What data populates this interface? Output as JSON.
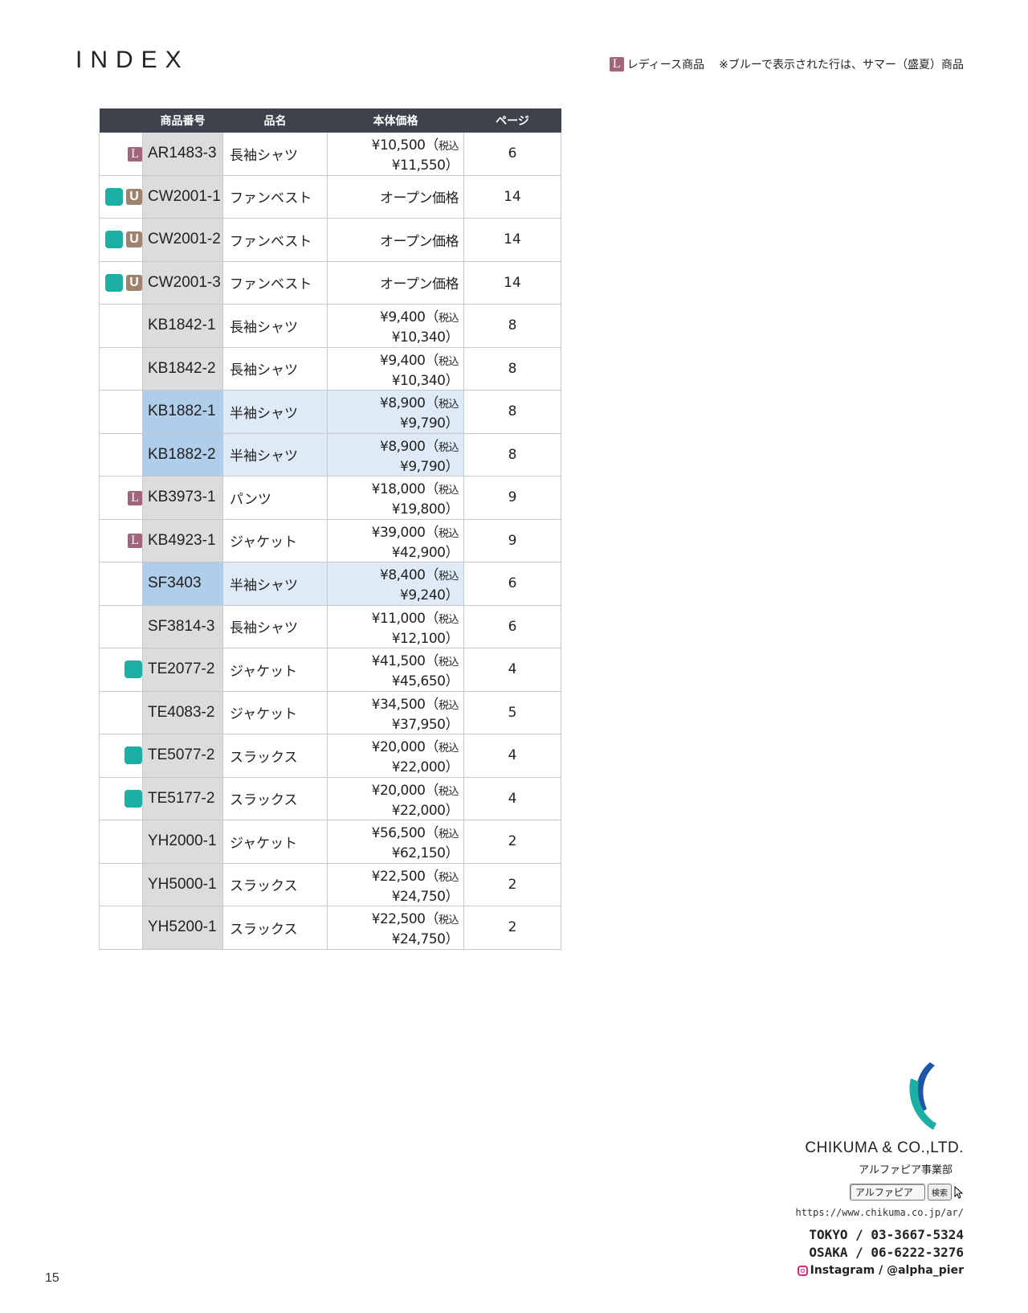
{
  "title": "INDEX",
  "legend": {
    "ladies_badge": "L",
    "ladies_label": "レディース商品",
    "summer_note": "※ブルーで表示された行は、サマー（盛夏）商品"
  },
  "table": {
    "headers": [
      "商品番号",
      "品名",
      "本体価格",
      "ページ"
    ],
    "rows": [
      {
        "badges": [
          "L"
        ],
        "code": "AR1483-3",
        "name": "長袖シャツ",
        "price": "¥10,500",
        "tax_label": "税込",
        "tax_price": "¥11,550",
        "page": "6",
        "summer": false
      },
      {
        "badges": [
          "T",
          "U"
        ],
        "code": "CW2001-1",
        "name": "ファンベスト",
        "price": "オープン価格",
        "tax_label": "",
        "tax_price": "",
        "page": "14",
        "summer": false
      },
      {
        "badges": [
          "T",
          "U"
        ],
        "code": "CW2001-2",
        "name": "ファンベスト",
        "price": "オープン価格",
        "tax_label": "",
        "tax_price": "",
        "page": "14",
        "summer": false
      },
      {
        "badges": [
          "T",
          "U"
        ],
        "code": "CW2001-3",
        "name": "ファンベスト",
        "price": "オープン価格",
        "tax_label": "",
        "tax_price": "",
        "page": "14",
        "summer": false
      },
      {
        "badges": [],
        "code": "KB1842-1",
        "name": "長袖シャツ",
        "price": "¥9,400",
        "tax_label": "税込",
        "tax_price": "¥10,340",
        "page": "8",
        "summer": false
      },
      {
        "badges": [],
        "code": "KB1842-2",
        "name": "長袖シャツ",
        "price": "¥9,400",
        "tax_label": "税込",
        "tax_price": "¥10,340",
        "page": "8",
        "summer": false
      },
      {
        "badges": [],
        "code": "KB1882-1",
        "name": "半袖シャツ",
        "price": "¥8,900",
        "tax_label": "税込",
        "tax_price": "¥9,790",
        "page": "8",
        "summer": true
      },
      {
        "badges": [],
        "code": "KB1882-2",
        "name": "半袖シャツ",
        "price": "¥8,900",
        "tax_label": "税込",
        "tax_price": "¥9,790",
        "page": "8",
        "summer": true
      },
      {
        "badges": [
          "L"
        ],
        "code": "KB3973-1",
        "name": "パンツ",
        "price": "¥18,000",
        "tax_label": "税込",
        "tax_price": "¥19,800",
        "page": "9",
        "summer": false
      },
      {
        "badges": [
          "L"
        ],
        "code": "KB4923-1",
        "name": "ジャケット",
        "price": "¥39,000",
        "tax_label": "税込",
        "tax_price": "¥42,900",
        "page": "9",
        "summer": false
      },
      {
        "badges": [],
        "code": "SF3403",
        "name": "半袖シャツ",
        "price": "¥8,400",
        "tax_label": "税込",
        "tax_price": "¥9,240",
        "page": "6",
        "summer": true
      },
      {
        "badges": [],
        "code": "SF3814-3",
        "name": "長袖シャツ",
        "price": "¥11,000",
        "tax_label": "税込",
        "tax_price": "¥12,100",
        "page": "6",
        "summer": false
      },
      {
        "badges": [
          "T"
        ],
        "code": "TE2077-2",
        "name": "ジャケット",
        "price": "¥41,500",
        "tax_label": "税込",
        "tax_price": "¥45,650",
        "page": "4",
        "summer": false
      },
      {
        "badges": [],
        "code": "TE4083-2",
        "name": "ジャケット",
        "price": "¥34,500",
        "tax_label": "税込",
        "tax_price": "¥37,950",
        "page": "5",
        "summer": false
      },
      {
        "badges": [
          "T"
        ],
        "code": "TE5077-2",
        "name": "スラックス",
        "price": "¥20,000",
        "tax_label": "税込",
        "tax_price": "¥22,000",
        "page": "4",
        "summer": false
      },
      {
        "badges": [
          "T"
        ],
        "code": "TE5177-2",
        "name": "スラックス",
        "price": "¥20,000",
        "tax_label": "税込",
        "tax_price": "¥22,000",
        "page": "4",
        "summer": false
      },
      {
        "badges": [],
        "code": "YH2000-1",
        "name": "ジャケット",
        "price": "¥56,500",
        "tax_label": "税込",
        "tax_price": "¥62,150",
        "page": "2",
        "summer": false
      },
      {
        "badges": [],
        "code": "YH5000-1",
        "name": "スラックス",
        "price": "¥22,500",
        "tax_label": "税込",
        "tax_price": "¥24,750",
        "page": "2",
        "summer": false
      },
      {
        "badges": [],
        "code": "YH5200-1",
        "name": "スラックス",
        "price": "¥22,500",
        "tax_label": "税込",
        "tax_price": "¥24,750",
        "page": "2",
        "summer": false
      }
    ]
  },
  "footer": {
    "company": "CHIKUMA & CO.,LTD.",
    "division": "アルファピア事業部",
    "search_value": "アルファピア",
    "search_button": "検索",
    "url": "https://www.chikuma.co.jp/ar/",
    "tokyo": "TOKYO / 03-3667-5324",
    "osaka": "OSAKA / 06-6222-3276",
    "instagram": "Instagram / @alpha_pier"
  },
  "page_number": "15",
  "colors": {
    "header_bg": "#3e424d",
    "ladies_badge": "#a0657a",
    "u_badge": "#9e8470",
    "teal_badge": "#1bb0a3",
    "summer_code_bg": "#b0cde9",
    "summer_row_bg": "#deebf7",
    "logo_blue": "#1e55a6",
    "logo_teal": "#1bb0a3"
  }
}
